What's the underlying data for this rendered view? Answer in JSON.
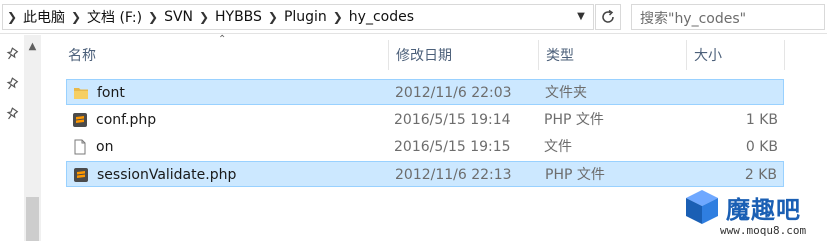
{
  "breadcrumb": [
    "此电脑",
    "文档 (F:)",
    "SVN",
    "HYBBS",
    "Plugin",
    "hy_codes"
  ],
  "search": {
    "placeholder": "搜索\"hy_codes\""
  },
  "columns": {
    "name": "名称",
    "date": "修改日期",
    "type": "类型",
    "size": "大小"
  },
  "files": [
    {
      "name": "font",
      "date": "2012/11/6 22:03",
      "type": "文件夹",
      "size": "",
      "icon": "folder-icon",
      "selected": true
    },
    {
      "name": "conf.php",
      "date": "2016/5/15 19:14",
      "type": "PHP 文件",
      "size": "1 KB",
      "icon": "sublime-file-icon",
      "selected": false
    },
    {
      "name": "on",
      "date": "2016/5/15 19:15",
      "type": "文件",
      "size": "0 KB",
      "icon": "blank-file-icon",
      "selected": false
    },
    {
      "name": "sessionValidate.php",
      "date": "2012/11/6 22:13",
      "type": "PHP 文件",
      "size": "2 KB",
      "icon": "sublime-file-icon",
      "selected": true
    }
  ],
  "watermark": {
    "title": "魔趣吧",
    "url": "www.moqu8.com"
  },
  "colors": {
    "selection": "#cce8ff",
    "selection_border": "#99d1ff",
    "header_text": "#4c607a",
    "brand": "#1a5fb4"
  }
}
